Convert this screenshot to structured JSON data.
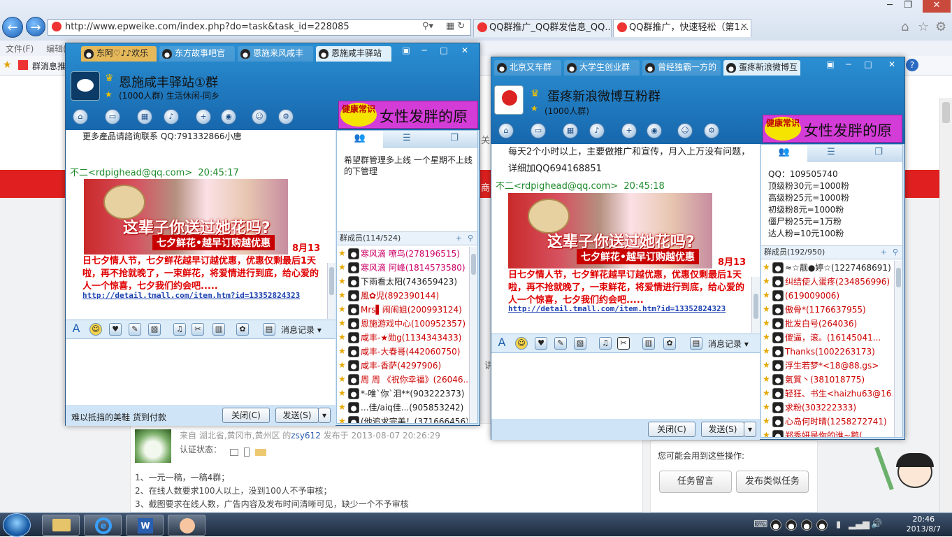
{
  "browser": {
    "url": "http://www.epweike.com/index.php?do=task&task_id=228085",
    "tabs": [
      "QQ群推广_QQ群发信息_QQ...",
      "QQ群推广，快速轻松（第1..."
    ],
    "menu": [
      "文件(F)",
      "编辑(E)"
    ],
    "fav": "群消息推"
  },
  "page": {
    "post_from": "来自 湖北省,黄冈市,黄州区 的",
    "post_user": "zsy612",
    "post_time": "发布于 2013-08-07 20:26:29",
    "auth_label": "认证状态：",
    "rules": [
      "1、一元一稿，一稿4群；",
      "2、在线人数要求100人以上，没到100人不予审核；",
      "3、截图要求在线人数，广告内容及发布时间清晰可见，缺少一个不予审核"
    ],
    "side_title": "您可能会用到这些操作:",
    "btn_message": "任务留言",
    "btn_similar": "发布类似任务",
    "side_char": "商",
    "side_char2": "关",
    "side_char3": "讲"
  },
  "qq1": {
    "tabs": [
      "东阿♡♪♪欢乐",
      "东方故事吧官",
      "恩施来风咸丰",
      "恩施咸丰驿站"
    ],
    "group_name": "恩施咸丰驿站①群",
    "group_meta": "(1000人群) 生活休闲-同乡",
    "ad_badge": "健康常识",
    "ad_text": "女性发胖的原因",
    "chat_top": "更多產品请諮询联系 QQ:791332866小唐",
    "sender": "不二<rdpighead@qq.com>",
    "time": "20:45:17",
    "img_t1": "这辈子你送过她花吗?",
    "img_t2": "七夕鲜花•越早订购越优惠",
    "date": "8月13",
    "promo": "日七夕情人节，七夕鲜花越早订越优惠，优惠仅剩最后1天啦，再不抢就晚了，一束鲜花，将爱情进行到底，给心爱的人一个惊喜，七夕我们约会吧.....",
    "link": "http://detail.tmall.com/item.htm?id=13352824323",
    "msg_record": "消息记录",
    "input_footer": "难以抵挡的美鞋 货到付款",
    "btn_close": "关闭(C)",
    "btn_send": "发送(S)",
    "notice": "希望群管理多上线 一个星期不上线的下管理",
    "member_head": "群成员(114/524)",
    "members": [
      {
        "name": "寒风滴 嘹鸟(278196515)",
        "color": "#cc0066"
      },
      {
        "name": "寒风滴 阿峰(1814573580)",
        "color": "#cc0066"
      },
      {
        "name": "下雨看太阳(743659423)",
        "color": "#222222"
      },
      {
        "name": "風✿児(892390144)",
        "color": "#cc0000"
      },
      {
        "name": "Mrs▌闹闹姐(200993124)",
        "color": "#cc0000"
      },
      {
        "name": "恩施游戏中心(100952357)",
        "color": "#cc0000"
      },
      {
        "name": "咸丰-★勋g(1134343433)",
        "color": "#cc0000"
      },
      {
        "name": "咸丰-大春哥(442060750)",
        "color": "#cc0000"
      },
      {
        "name": "咸丰-香萨(4297906)",
        "color": "#cc0000"
      },
      {
        "name": "周 周 《祝你幸福》(26046...",
        "color": "#cc0000"
      },
      {
        "name": "*-唯`你`泪**(903222373)",
        "color": "#222222"
      },
      {
        "name": "...佳/aiq佳...(905853242)",
        "color": "#222222"
      },
      {
        "name": "(他追求完美！(371666456)",
        "color": "#222222"
      }
    ]
  },
  "qq2": {
    "tabs": [
      "北京又车群",
      "大学生创业群",
      "曾经独霸一方的",
      "蛋疼新浪微博互"
    ],
    "group_name": "蛋疼新浪微博互粉群",
    "group_meta": "(1000人群)",
    "ad_badge": "健康常识",
    "ad_text": "女性发胖的原因",
    "chat_top1": "每天2个小时以上，主要做推广和宣传，月入上万没有问题，",
    "chat_top2": "详细加QQ694168851",
    "sender": "不二<rdpighead@qq.com>",
    "time": "20:45:18",
    "img_t1": "这辈子你送过她花吗?",
    "img_t2": "七夕鲜花•越早订购越优惠",
    "date": "8月13",
    "promo": "日七夕情人节，七夕鲜花越早订越优惠，优惠仅剩最后1天啦，再不抢就晚了，一束鲜花，将爱情进行到底，给心爱的人一个惊喜，七夕我们约会吧.....",
    "link": "http://detail.tmall.com/item.htm?id=13352824323",
    "msg_record": "消息记录",
    "btn_close": "关闭(C)",
    "btn_send": "发送(S)",
    "notice": [
      "QQ：109505740",
      "顶级粉30元=1000粉",
      "高级粉25元=1000粉",
      "初级粉8元=1000粉",
      "僵尸粉25元=1万粉",
      "达人粉=10元100粉"
    ],
    "member_head": "群成员(192/950)",
    "members": [
      {
        "name": "≈☆靓●婷☆(1227468691)",
        "color": "#222222"
      },
      {
        "name": "纠结使人蛋疼(234856996)",
        "color": "#cc0000"
      },
      {
        "name": "(619009006)",
        "color": "#cc0000"
      },
      {
        "name": "傲骨*(1176637955)",
        "color": "#cc0000"
      },
      {
        "name": "批发白号(264036)",
        "color": "#cc0000"
      },
      {
        "name": "傻逼，滚。(16145041...",
        "color": "#cc0000"
      },
      {
        "name": "Thanks(1002263173)",
        "color": "#cc0000"
      },
      {
        "name": "浮生若梦*<18@88.gs>",
        "color": "#cc0000"
      },
      {
        "name": "氣質丶(381018775)",
        "color": "#cc0000"
      },
      {
        "name": "轻狂、书生<haizhu63@16...",
        "color": "#cc0000"
      },
      {
        "name": "求粉(303222333)",
        "color": "#cc0000"
      },
      {
        "name": "心岛何时晴(1258272741)",
        "color": "#cc0000"
      },
      {
        "name": "郑秀妍是你的谁~鹅(...",
        "color": "#cc0000"
      }
    ]
  },
  "taskbar": {
    "time": "20:46",
    "date": "2013/8/7"
  }
}
